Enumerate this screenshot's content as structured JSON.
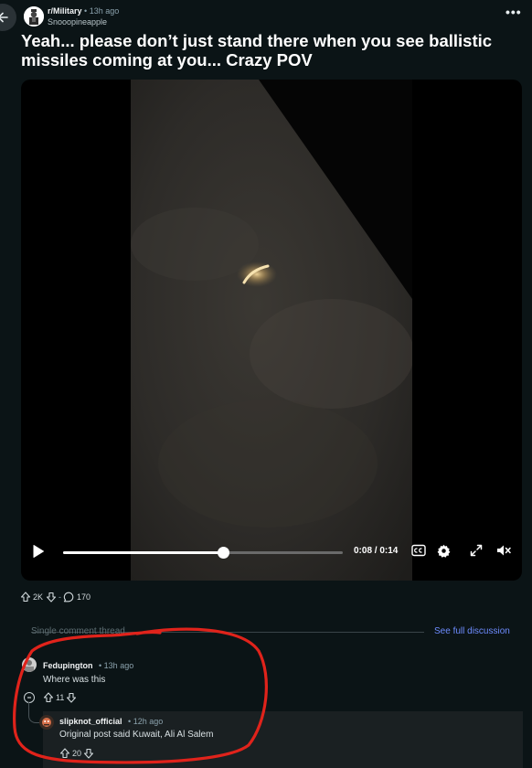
{
  "post": {
    "subreddit": "r/Military",
    "dot": "•",
    "time": "13h ago",
    "author": "Snooopineapple",
    "title": "Yeah... please don’t just stand there when you see ballistic missiles coming at you... Crazy POV",
    "more": "•••"
  },
  "video": {
    "time_display": "0:08 / 0:14",
    "progress": 0.5714
  },
  "actions": {
    "upvotes": "2K",
    "separator": "-",
    "comments": "170"
  },
  "thread": {
    "label": "Single comment thread",
    "see_full": "See full discussion"
  },
  "comments": [
    {
      "user": "Fedupington",
      "dot": "•",
      "time": "13h ago",
      "body": "Where was this",
      "votes": "11"
    },
    {
      "user": "slipknot_official",
      "dot": "•",
      "time": "12h ago",
      "body": "Original post said Kuwait, Ali Al Salem",
      "votes": "20"
    }
  ],
  "colors": {
    "background": "#0b1416",
    "link": "#6e8cff",
    "annotation": "#e0231b"
  }
}
